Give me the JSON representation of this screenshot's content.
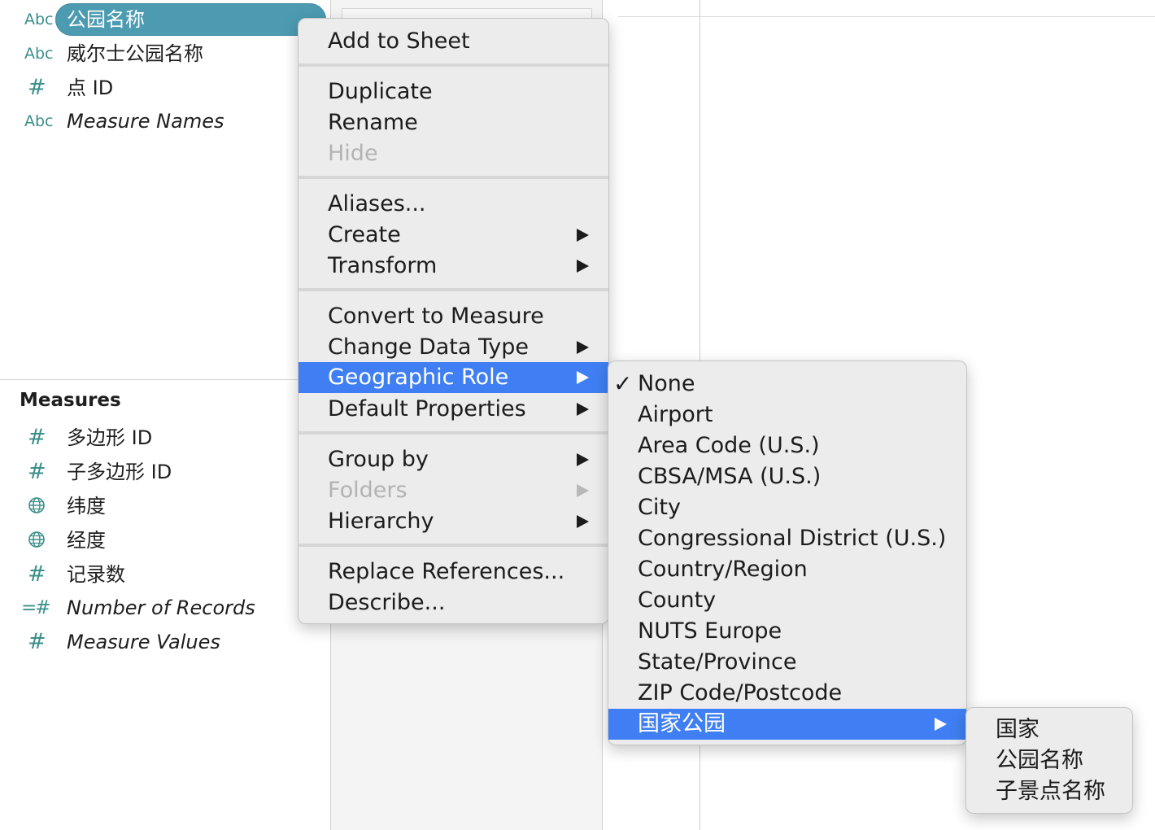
{
  "dimensions": {
    "fields": [
      {
        "type": "Abc",
        "name": "公园名称",
        "selected": true
      },
      {
        "type": "Abc",
        "name": "威尔士公园名称"
      },
      {
        "type": "#",
        "name": "点 ID"
      },
      {
        "type": "Abc",
        "name": "Measure Names",
        "italic": true
      }
    ]
  },
  "measures": {
    "title": "Measures",
    "fields": [
      {
        "type": "#",
        "name": "多边形 ID"
      },
      {
        "type": "#",
        "name": "子多边形 ID"
      },
      {
        "type": "globe",
        "name": "纬度"
      },
      {
        "type": "globe",
        "name": "经度"
      },
      {
        "type": "#",
        "name": "记录数"
      },
      {
        "type": "=#",
        "name": "Number of Records",
        "italic": true
      },
      {
        "type": "#",
        "name": "Measure Values",
        "italic": true
      }
    ]
  },
  "context_menu": {
    "items": {
      "add_to_sheet": "Add to Sheet",
      "duplicate": "Duplicate",
      "rename": "Rename",
      "hide": "Hide",
      "aliases": "Aliases...",
      "create": "Create",
      "transform": "Transform",
      "convert_to_measure": "Convert to Measure",
      "change_data_type": "Change Data Type",
      "geographic_role": "Geographic Role",
      "default_properties": "Default Properties",
      "group_by": "Group by",
      "folders": "Folders",
      "hierarchy": "Hierarchy",
      "replace_references": "Replace References...",
      "describe": "Describe..."
    }
  },
  "geo_submenu": {
    "check": "✓",
    "items": [
      "None",
      "Airport",
      "Area Code (U.S.)",
      "CBSA/MSA (U.S.)",
      "City",
      "Congressional District (U.S.)",
      "Country/Region",
      "County",
      "NUTS Europe",
      "State/Province",
      "ZIP Code/Postcode",
      "国家公园"
    ],
    "checked_item": "None",
    "highlighted_item": "国家公园"
  },
  "park_submenu": {
    "items": [
      "国家",
      "公园名称",
      "子景点名称"
    ]
  },
  "colors": {
    "highlight": "#3f7ff3",
    "pill": "#4c9bb1",
    "field_type_icon": "#3b8f8a"
  }
}
